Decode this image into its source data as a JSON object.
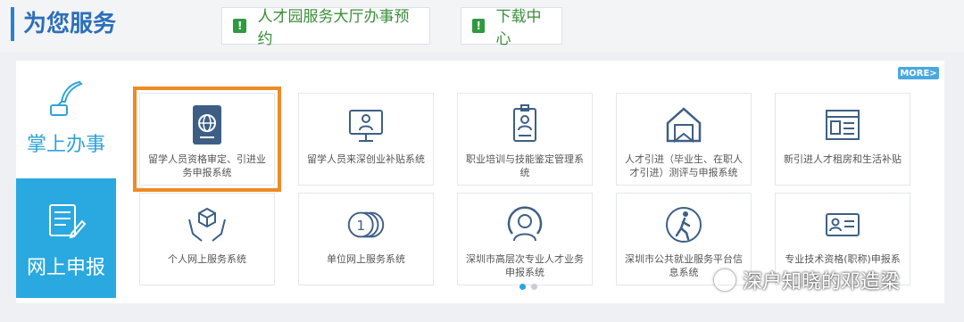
{
  "section_title": "为您服务",
  "top_links": [
    {
      "label": "人才园服务大厅办事预约",
      "icon": "notice-icon"
    },
    {
      "label": "下载中心",
      "icon": "notice-icon"
    }
  ],
  "side_tabs": [
    {
      "label": "掌上办事",
      "icon": "quill-pen-icon",
      "active": false
    },
    {
      "label": "网上申报",
      "icon": "document-pen-icon",
      "active": true
    }
  ],
  "more_label": "MORE>",
  "cards": [
    {
      "title": "留学人员资格审定、引进业务申报系统",
      "icon": "passport-icon",
      "highlighted": true
    },
    {
      "title": "留学人员来深创业补贴系统",
      "icon": "monitor-person-icon"
    },
    {
      "title": "职业培训与技能鉴定管理系统",
      "icon": "id-badge-icon"
    },
    {
      "title": "人才引进（毕业生、在职人才引进）测评与申报系统",
      "icon": "house-icon"
    },
    {
      "title": "新引进人才租房和生活补贴",
      "icon": "webpage-icon"
    },
    {
      "title": "个人网上服务系统",
      "icon": "hands-cube-icon"
    },
    {
      "title": "单位网上服务系统",
      "icon": "coins-icon"
    },
    {
      "title": "深圳市高层次专业人才业务申报系统",
      "icon": "user-circle-icon"
    },
    {
      "title": "深圳市公共就业服务平台信息系统",
      "icon": "walking-person-icon"
    },
    {
      "title": "专业技术资格(职称)申报系",
      "icon": "id-card-icon"
    }
  ],
  "pagination": {
    "total": 2,
    "current": 1
  },
  "watermark": "深户知晓的邓造梁",
  "colors": {
    "accent": "#29a9e0",
    "highlight": "#f08a24",
    "green": "#2e9a40",
    "icon": "#3d5f85"
  }
}
